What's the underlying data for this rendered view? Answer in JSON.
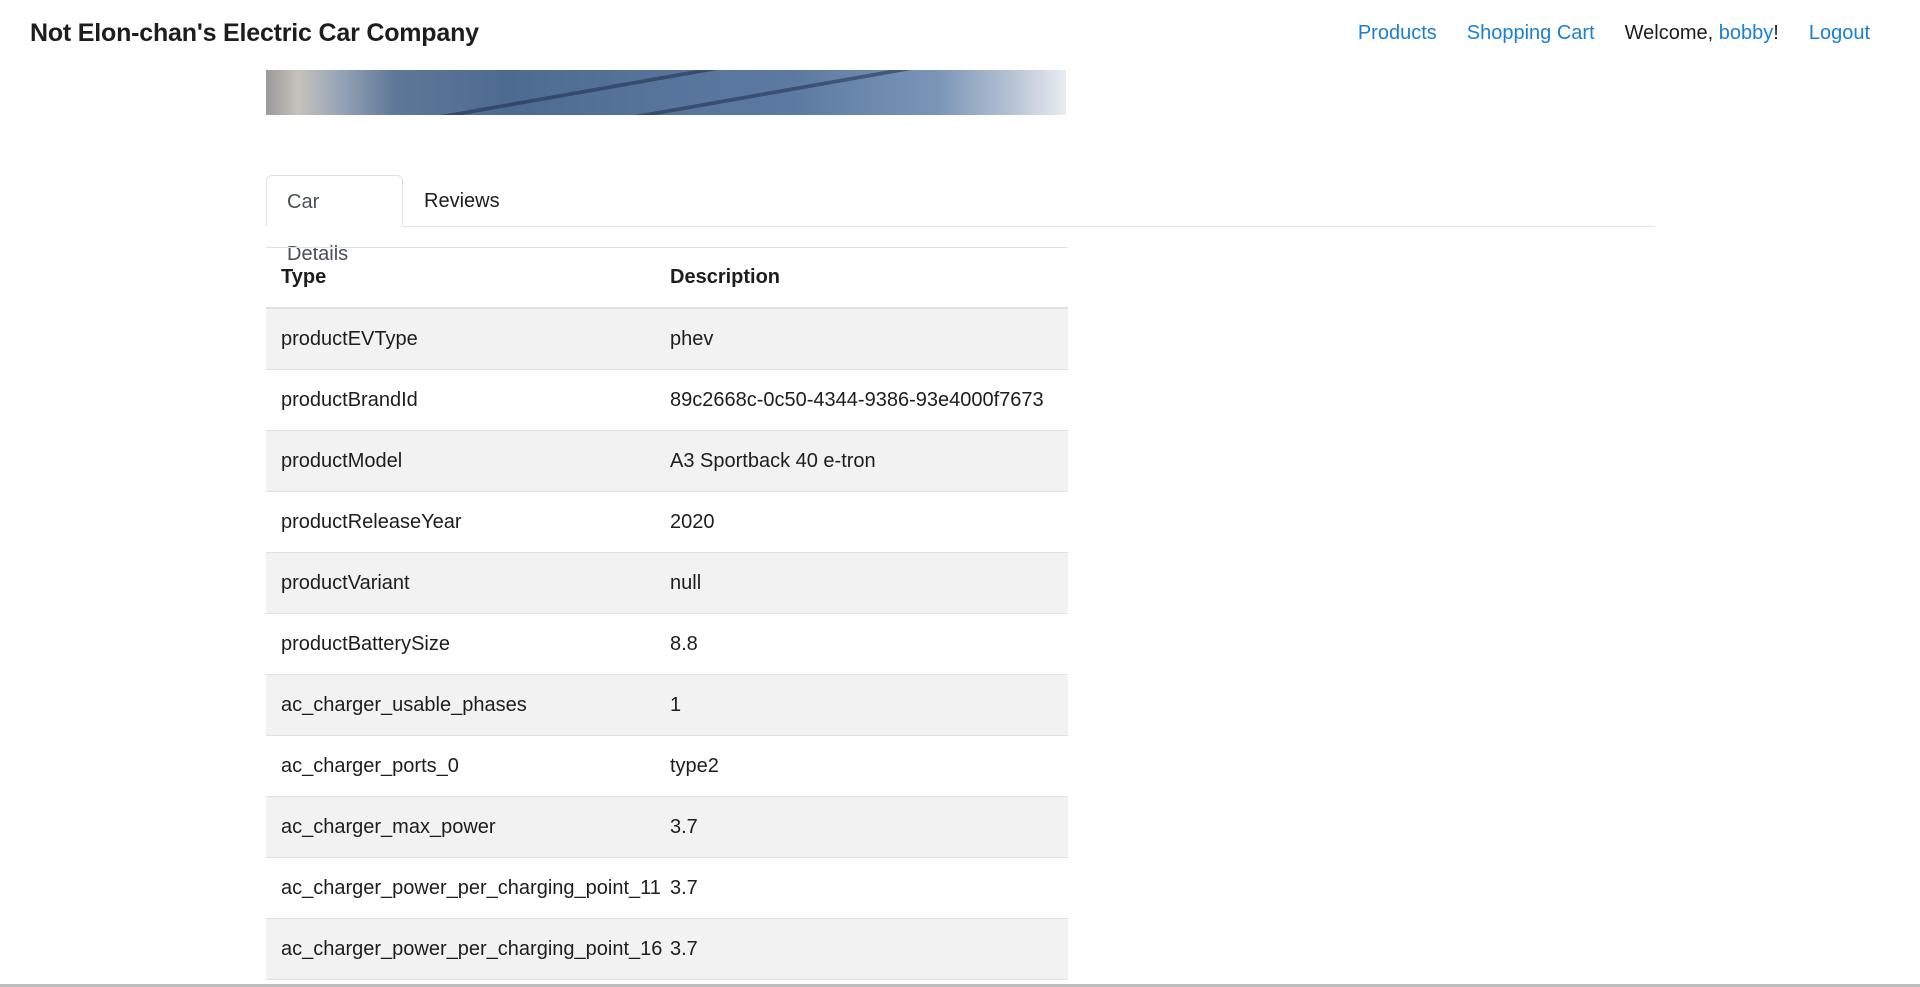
{
  "navbar": {
    "brand": "Not Elon-chan's Electric Car Company",
    "products_label": "Products",
    "cart_label": "Shopping Cart",
    "welcome_prefix": "Welcome, ",
    "username": "bobby",
    "welcome_suffix": "!",
    "logout_label": "Logout"
  },
  "tabs": [
    {
      "label": "Car Details",
      "active": true
    },
    {
      "label": "Reviews",
      "active": false
    }
  ],
  "table": {
    "headers": [
      "Type",
      "Description"
    ],
    "rows": [
      [
        "productEVType",
        "phev"
      ],
      [
        "productBrandId",
        "89c2668c-0c50-4344-9386-93e4000f7673"
      ],
      [
        "productModel",
        "A3 Sportback 40 e-tron"
      ],
      [
        "productReleaseYear",
        "2020"
      ],
      [
        "productVariant",
        "null"
      ],
      [
        "productBatterySize",
        "8.8"
      ],
      [
        "ac_charger_usable_phases",
        "1"
      ],
      [
        "ac_charger_ports_0",
        "type2"
      ],
      [
        "ac_charger_max_power",
        "3.7"
      ],
      [
        "ac_charger_power_per_charging_point_11",
        "3.7"
      ],
      [
        "ac_charger_power_per_charging_point_16",
        "3.7"
      ]
    ]
  },
  "colors": {
    "link": "#1b7fd1",
    "row_stripe": "#f2f2f2",
    "border": "#dee2e6"
  }
}
